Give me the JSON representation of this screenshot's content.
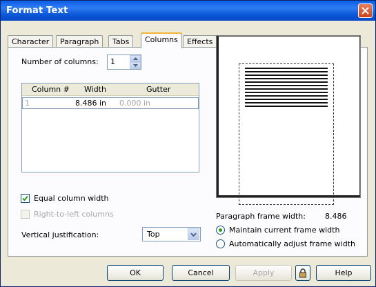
{
  "window": {
    "title": "Format Text"
  },
  "tabs": [
    {
      "label": "Character"
    },
    {
      "label": "Paragraph"
    },
    {
      "label": "Tabs"
    },
    {
      "label": "Columns",
      "active": true
    },
    {
      "label": "Effects"
    }
  ],
  "columns": {
    "number_label": "Number of columns:",
    "number_value": "1",
    "table": {
      "headers": [
        "Column #",
        "Width",
        "Gutter"
      ],
      "rows": [
        {
          "column": "1",
          "width": "8.486 in",
          "gutter": "0.000 in"
        }
      ]
    },
    "equal_width_label": "Equal column width",
    "equal_width_checked": true,
    "rtl_label": "Right-to-left columns",
    "rtl_checked": false,
    "vjust_label": "Vertical justification:",
    "vjust_value": "Top"
  },
  "paragraph_frame": {
    "width_label": "Paragraph frame width:",
    "width_value": "8.486",
    "maintain_label": "Maintain current frame width",
    "auto_label": "Automatically adjust frame width",
    "selected": "maintain"
  },
  "buttons": {
    "ok": "OK",
    "cancel": "Cancel",
    "apply": "Apply",
    "help": "Help"
  },
  "colors": {
    "titlebar": "#0b58d8",
    "dialog_bg": "#ece9d8",
    "active_tab_accent": "#f3b43b",
    "radio_selected": "#2b9a2b"
  }
}
